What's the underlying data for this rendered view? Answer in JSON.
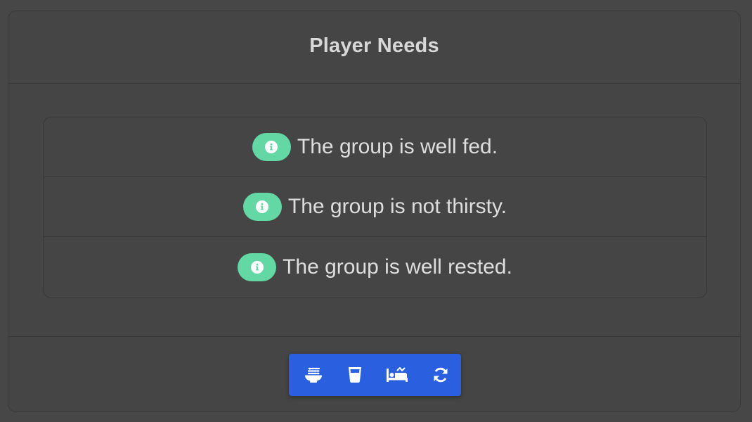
{
  "panel": {
    "title": "Player Needs"
  },
  "statuses": [
    {
      "text": "The group is well fed.",
      "icon": "info-icon"
    },
    {
      "text": "The group is not thirsty.",
      "icon": "info-icon"
    },
    {
      "text": "The group is well rested.",
      "icon": "info-icon"
    }
  ],
  "toolbar": {
    "buttons": [
      {
        "action": "feed",
        "icon": "food-bowl-icon"
      },
      {
        "action": "drink",
        "icon": "glass-icon"
      },
      {
        "action": "rest",
        "icon": "bed-icon"
      },
      {
        "action": "refresh",
        "icon": "refresh-icon"
      }
    ]
  },
  "colors": {
    "background": "#474747",
    "badge": "#63d8a5",
    "toolbar": "#2a5fe0",
    "text": "#dedede"
  }
}
